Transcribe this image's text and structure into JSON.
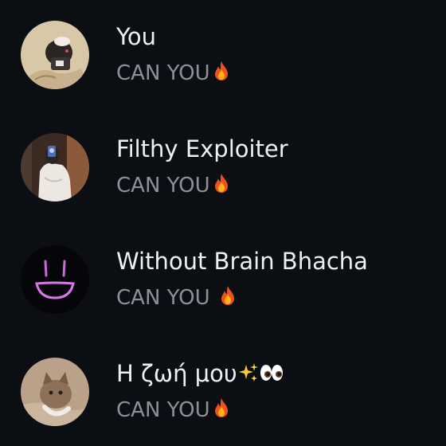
{
  "contacts": [
    {
      "name": "You",
      "message": "CAN YOU",
      "message_emoji": "flame-emoji",
      "avatar": "avatar-user-photo"
    },
    {
      "name": "Filthy Exploiter",
      "message": "CAN YOU",
      "message_emoji": "flame-emoji",
      "avatar": "avatar-mirror-selfie"
    },
    {
      "name": "Without Brain Bhacha",
      "message": "CAN YOU ",
      "message_emoji": "flame-emoji",
      "avatar": "avatar-neon-face"
    },
    {
      "name": "Η ζωή μου",
      "name_emoji": [
        "sparkles-emoji",
        "eyes-emoji"
      ],
      "message": "CAN YOU",
      "message_emoji": "flame-emoji",
      "avatar": "avatar-cat-photo"
    }
  ],
  "colors": {
    "background": "#0b0f14",
    "name_text": "#eef0f2",
    "message_text": "#8b9197"
  }
}
